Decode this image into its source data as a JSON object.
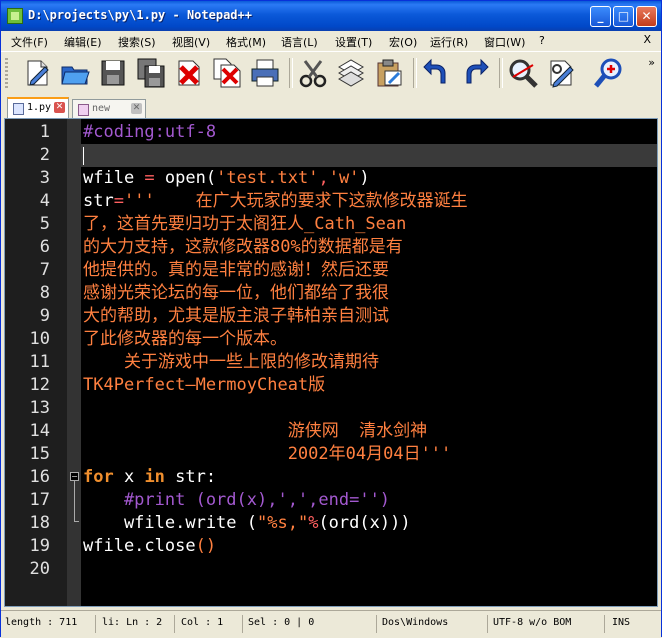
{
  "window": {
    "title": "D:\\projects\\py\\1.py - Notepad++",
    "minimize": "_",
    "maximize": "□",
    "close": "✕"
  },
  "menu": {
    "items": [
      "文件(F)",
      "编辑(E)",
      "搜索(S)",
      "视图(V)",
      "格式(M)",
      "语言(L)",
      "设置(T)",
      "宏(O)",
      "运行(R)",
      "窗口(W)",
      "?"
    ],
    "close_x": "X"
  },
  "toolbar": {
    "icons": [
      "new-file-icon",
      "open-folder-icon",
      "save-icon",
      "save-all-icon",
      "close-file-icon",
      "close-all-icon",
      "print-icon",
      "cut-icon",
      "copy-icon",
      "paste-icon",
      "undo-icon",
      "redo-icon",
      "find-icon",
      "replace-icon",
      "zoom-in-icon"
    ],
    "overflow": "»"
  },
  "tabs": [
    {
      "label": "1.py",
      "active": true
    },
    {
      "label": "new",
      "active": false
    }
  ],
  "editor": {
    "line_numbers": [
      "1",
      "2",
      "3",
      "4",
      "5",
      "6",
      "7",
      "8",
      "9",
      "10",
      "11",
      "12",
      "13",
      "14",
      "15",
      "16",
      "17",
      "18",
      "19",
      "20"
    ],
    "current_line": 2,
    "lines": {
      "l1": "#coding:utf-8",
      "l3_a": "wfile ",
      "l3_b": "=",
      "l3_c": " open(",
      "l3_d": "'test.txt'",
      "l3_e": ",",
      "l3_f": "'w'",
      "l3_g": ")",
      "l4_a": "str",
      "l4_b": "=",
      "l4_c": "'''    在广大玩家的要求下这款修改器诞生",
      "l5": "了，这首先要归功于太阁狂人_Cath_Sean",
      "l6": "的大力支持，这款修改器80%的数据都是有",
      "l7": "他提供的。真的是非常的感谢！然后还要",
      "l8": "感谢光荣论坛的每一位，他们都给了我很",
      "l9": "大的帮助，尤其是版主浪子韩柏亲自测试",
      "l10": "了此修改器的每一个版本。",
      "l11": "    关于游戏中一些上限的修改请期待",
      "l12": "TK4Perfect—MermoyCheat版",
      "l14": "                    游侠网  清水剑神",
      "l15": "                    2002年04月04日'''",
      "l16_a": "for",
      "l16_b": " x ",
      "l16_c": "in",
      "l16_d": " str:",
      "l17": "    #print (ord(x),',',end='')",
      "l18_a": "    wfile.write (",
      "l18_b": "\"%s,\"",
      "l18_c": "%",
      "l18_d": "(ord(x)))",
      "l19_a": "wfile.close",
      "l19_b": "()"
    }
  },
  "status": {
    "length": "length : 711",
    "ln": "li: Ln : 2",
    "col": "Col : 1",
    "sel": "Sel : 0 | 0",
    "eol": "Dos\\Windows",
    "encoding": "UTF-8 w/o BOM",
    "mode": "INS"
  },
  "colors": {
    "keyword": "#f08f2e",
    "string": "#ff8040",
    "comment": "#a359d0",
    "operator": "#ff6060",
    "title_bar": "#0b59d9"
  }
}
